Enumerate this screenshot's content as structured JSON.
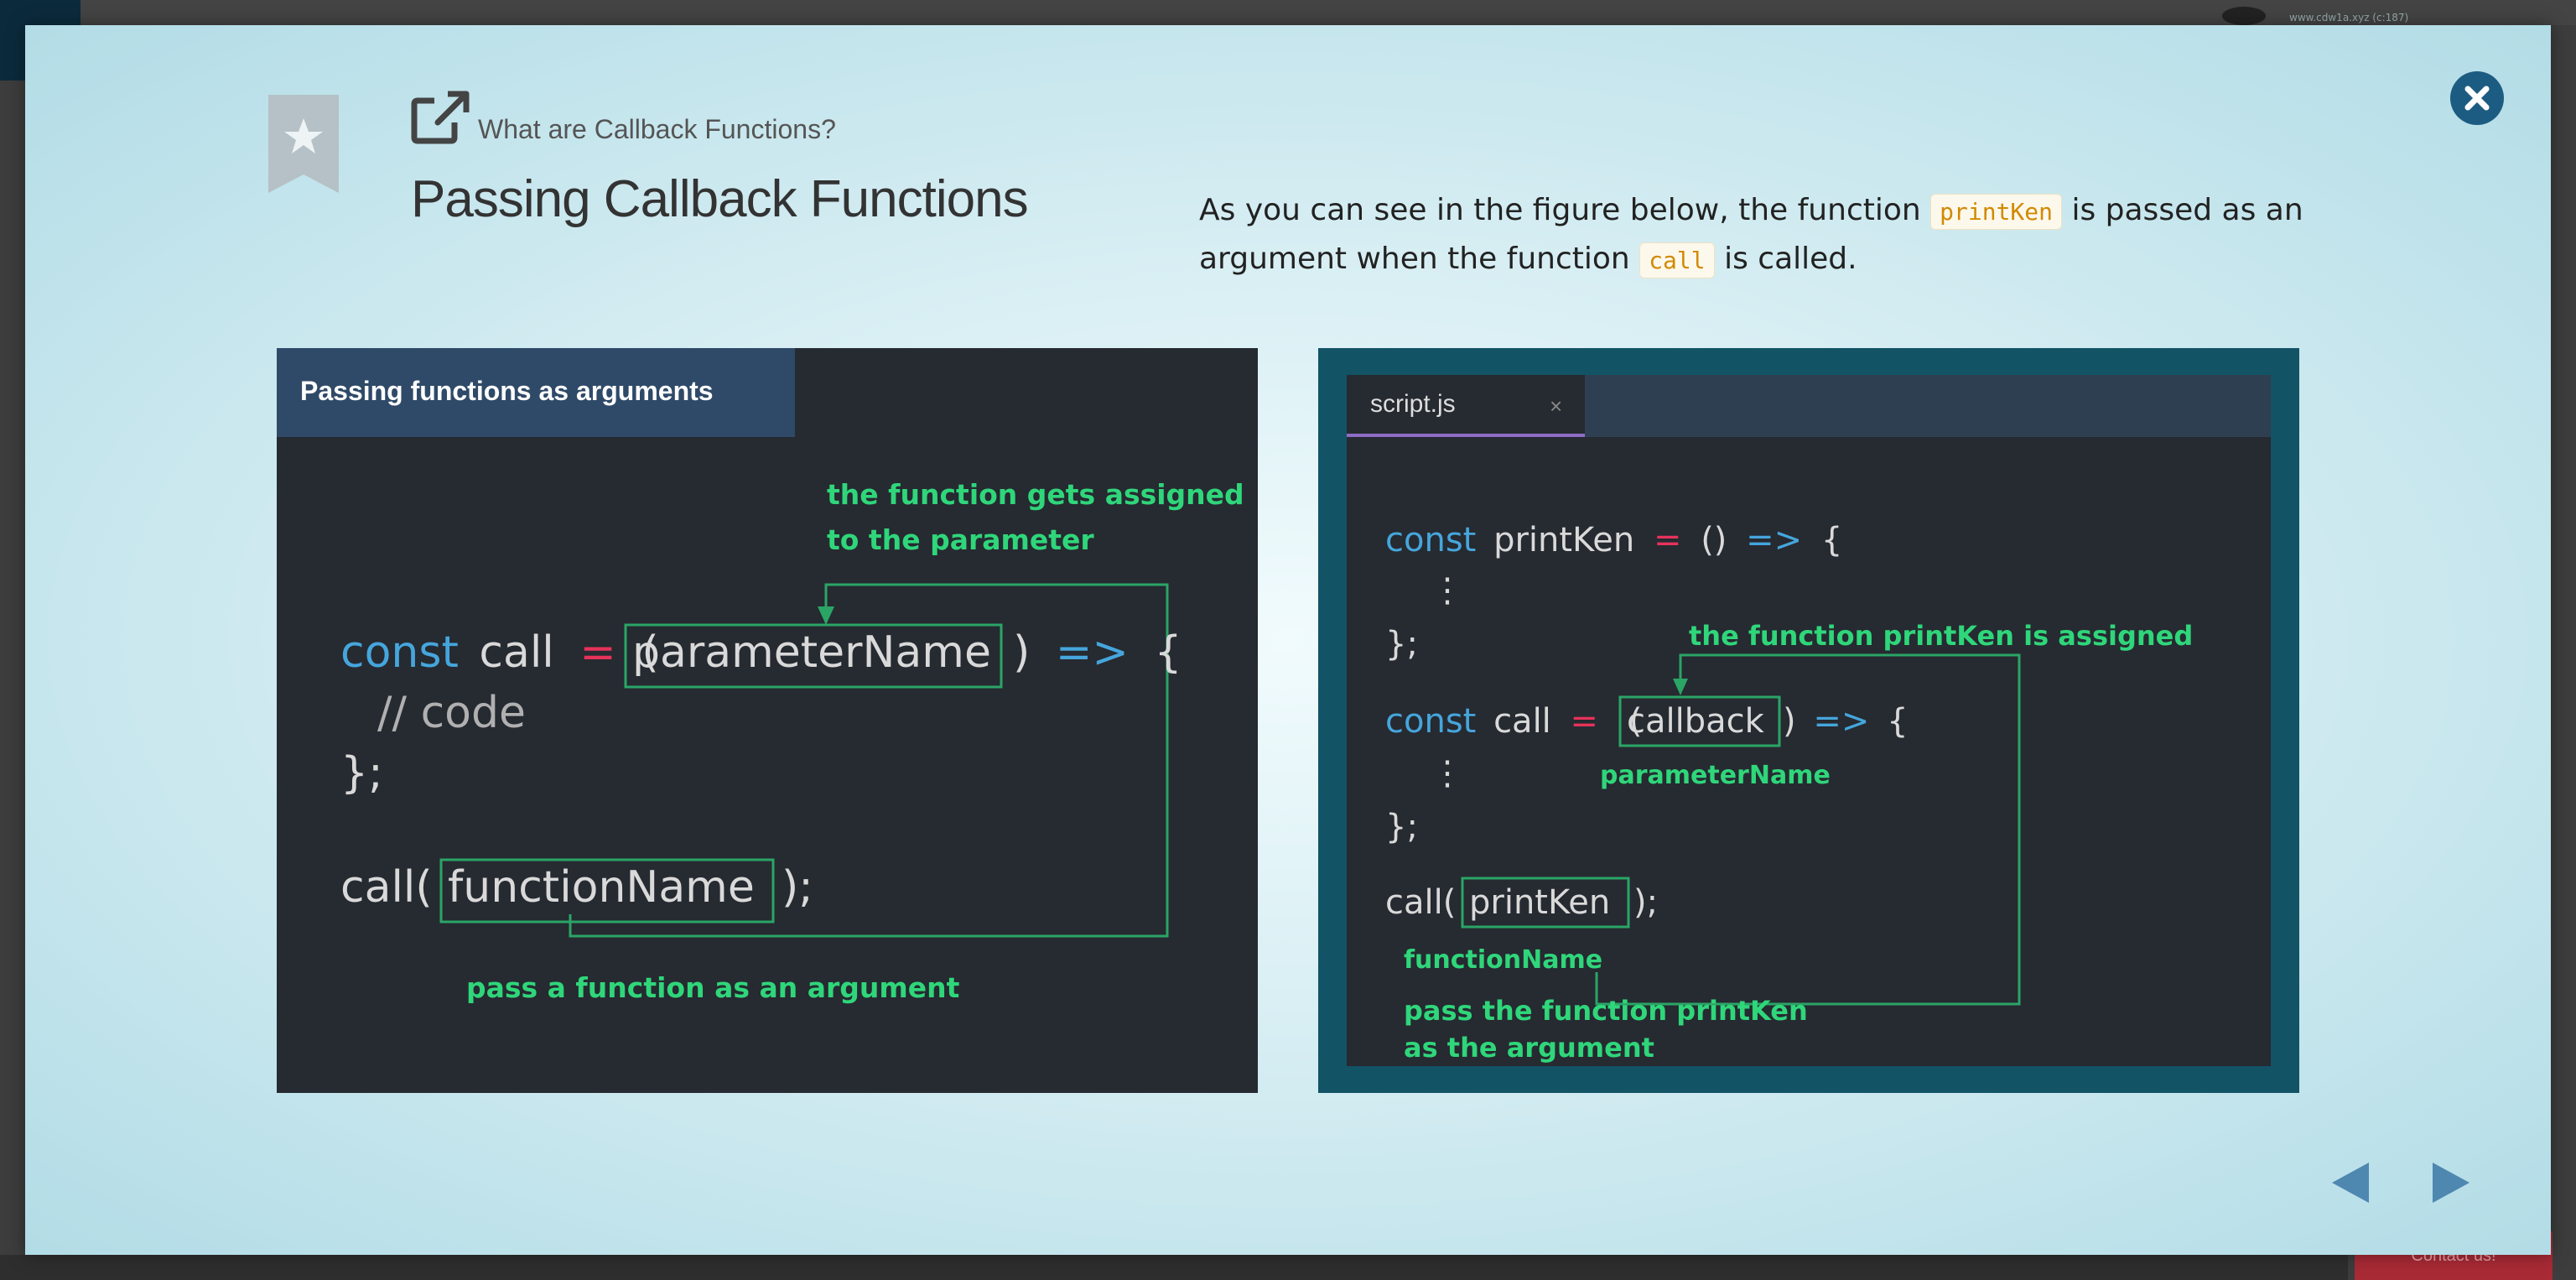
{
  "background": {
    "url_text": "www.cdw1a.xyz (c:187)",
    "contact_label": "Contact us!"
  },
  "modal": {
    "kicker": "What are Callback Functions?",
    "title": "Passing Callback Functions",
    "description": {
      "part1": "As you can see in the figure below, the function ",
      "code1": "printKen",
      "part2": " is passed as an argument when the function ",
      "code2": "call",
      "part3": " is called."
    },
    "icons": {
      "bookmark": "bookmark-star-icon",
      "external": "external-link-icon",
      "close": "close-icon",
      "prev": "prev-arrow-icon",
      "next": "next-arrow-icon"
    }
  },
  "figure_left": {
    "header": "Passing functions as arguments",
    "kw_const": "const",
    "name_call": "call",
    "eq": "=",
    "paren_open": "(",
    "param": "parameterName",
    "paren_arrow": ")",
    "arrow": "=>",
    "brace_open": "{",
    "comment": "// code",
    "brace_close": "};",
    "call_open": "call(",
    "fn_name": "functionName",
    "call_close": ");",
    "annot_top_1": "the function gets assigned",
    "annot_top_2": "to the parameter",
    "annot_bottom": "pass a function as an argument"
  },
  "figure_right": {
    "tab_name": "script.js",
    "tab_close": "×",
    "kw_const": "const",
    "name_printken": "printKen",
    "eq": "=",
    "parens": "()",
    "arrow": "=>",
    "brace_open": "{",
    "ellipsis": "⋮",
    "brace_close": "};",
    "name_call": "call",
    "paren_open": "(",
    "param": "callback",
    "paren_close": ")",
    "call_open": "call(",
    "arg": "printKen",
    "call_close": ");",
    "annot_top": "the function printKen is assigned",
    "annot_param": "parameterName",
    "annot_fn": "functionName",
    "annot_bottom_1": "pass the function printKen",
    "annot_bottom_2": "as the argument"
  },
  "colors": {
    "keyword": "#45a6dc",
    "operator": "#e6335a",
    "code_text": "#d9d9d9",
    "annotation": "#2fd67a",
    "box": "#2aa566",
    "inline_code": "#d18a00"
  }
}
